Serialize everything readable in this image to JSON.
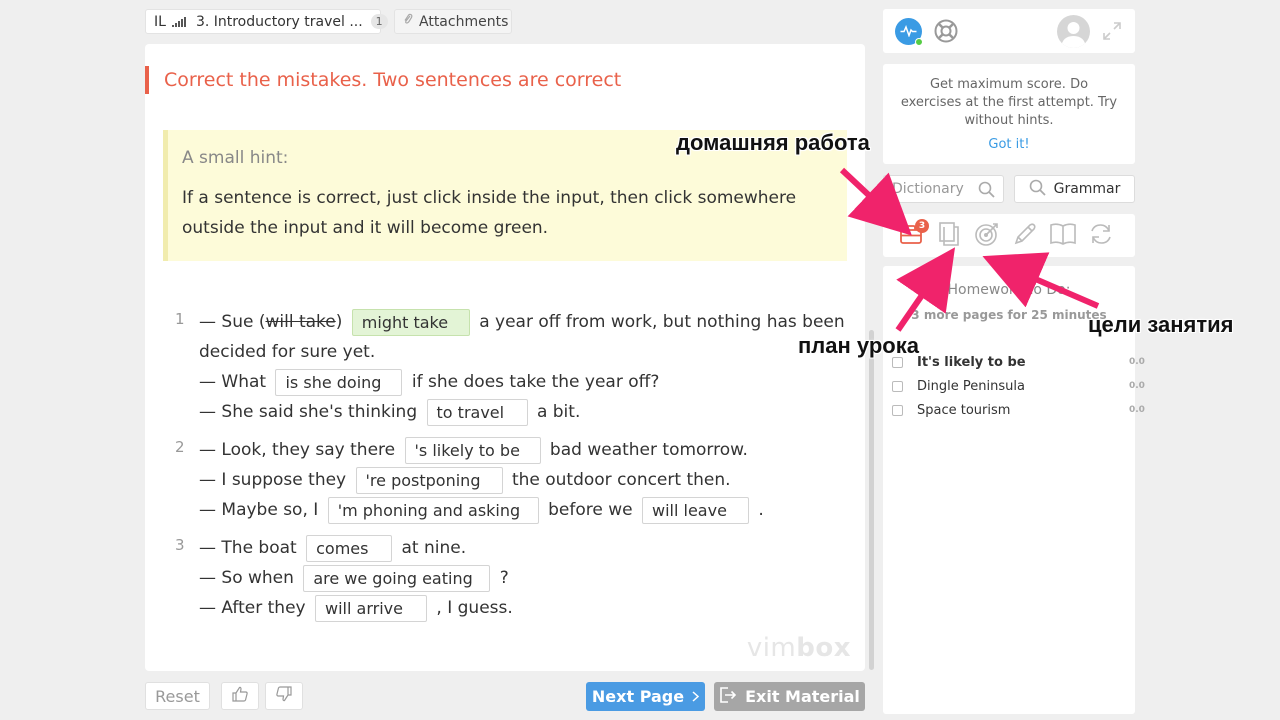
{
  "tabs": {
    "lesson": {
      "level": "IL",
      "title": "3. Introductory travel ...",
      "count": "1"
    },
    "attachments": "Attachments"
  },
  "task": {
    "title": "Correct the mistakes. Two sentences are correct",
    "hint_title": "A small hint:",
    "hint_text": "If a sentence is correct, just click inside the input, then click somewhere outside the input and it will become green."
  },
  "exercises": [
    {
      "number": "1",
      "t1": "— Sue (",
      "struck": "will take",
      "t2": ")",
      "a1": "might take",
      "t3": "a year off from work, but nothing has been decided for sure yet.",
      "t4": "— What",
      "a2": "is she doing",
      "t5": "if she does take the year off?",
      "t6": "— She said she's thinking",
      "a3": "to travel",
      "t7": "a bit."
    },
    {
      "number": "2",
      "t1": "— Look, they say there",
      "a1": "'s likely to be",
      "t2": "bad weather tomorrow.",
      "t3": "— I suppose they",
      "a2": "'re postponing",
      "t4": "the outdoor concert then.",
      "t5": "— Maybe so, I",
      "a3": "'m phoning and asking",
      "t6": "before we",
      "a4": "will leave",
      "t7": "."
    },
    {
      "number": "3",
      "t1": "— The boat",
      "a1": "comes",
      "t2": "at nine.",
      "t3": "— So when",
      "a2": "are we going eating",
      "t4": "?",
      "t5": "— After they",
      "a3": "will arrive",
      "t6": ", I guess."
    }
  ],
  "watermark": {
    "light": "vim",
    "bold": "box"
  },
  "buttons": {
    "reset": "Reset",
    "next": "Next Page",
    "exit": "Exit Material",
    "dictionary": "Dictionary",
    "grammar": "Grammar"
  },
  "tip": {
    "text": "Get maximum score. Do exercises at the first attempt. Try without hints.",
    "link": "Got it!"
  },
  "tools": {
    "homework_badge": "3"
  },
  "homework": {
    "title": "Homework To Do:",
    "subtitle": "3 more pages for 25 minutes",
    "items": [
      {
        "label": "It's likely to be",
        "score": "0.0"
      },
      {
        "label": "Dingle Peninsula",
        "score": "0.0"
      },
      {
        "label": "Space tourism",
        "score": "0.0"
      }
    ]
  },
  "annotations": {
    "homework": "домашняя работа",
    "lesson_plan": "план урока",
    "lesson_goals": "цели занятия"
  },
  "colors": {
    "accent_red": "#e9614a",
    "primary_blue": "#4a9be3",
    "annotation_arrow": "#f0236b",
    "correct_green": "#e3f4d6",
    "hint_bg": "#fdfbd9"
  }
}
